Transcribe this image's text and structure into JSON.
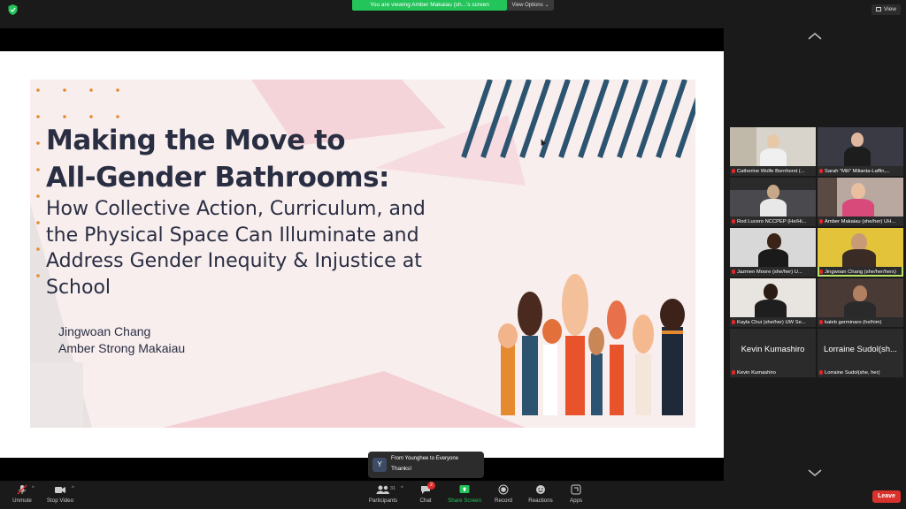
{
  "banner": {
    "viewing": "You are viewing Amber Makaiau (sh...'s screen",
    "view_options": "View Options ⌄"
  },
  "view_button": "View",
  "slide": {
    "title_line1": "Making the Move to",
    "title_line2": "All-Gender Bathrooms:",
    "subtitle_line1": "How Collective Action, Curriculum, and",
    "subtitle_line2": "the Physical Space Can Illuminate and",
    "subtitle_line3": "Address Gender Inequity & Injustice at",
    "subtitle_line4": "School",
    "author1": "Jingwoan Chang",
    "author2": "Amber Strong Makaiau",
    "colors": {
      "navy": "#2a2e42",
      "orange": "#e58a2e",
      "pink": "#f4cfd4",
      "slide_bg": "#f8eeee"
    }
  },
  "participants_panel": {
    "tiles": [
      {
        "name": "Catherine Wolfe Bornhorst (..."
      },
      {
        "name": "Sarah \"Mili\" Milianta-Laffin,..."
      },
      {
        "name": "Rod Lucero NCCPEP (He/Hi..."
      },
      {
        "name": "Amber Makaiau (she/her) UH..."
      },
      {
        "name": "Jazmen Moore (she/her) U..."
      },
      {
        "name": "Jingwoan Chang  (she/her/hers)"
      },
      {
        "name": "Kayla Chui (she/her) UW Se..."
      },
      {
        "name": "kaleb germinaro (he/him)"
      },
      {
        "name": "Kevin Kumashiro",
        "display": "Kevin Kumashiro"
      },
      {
        "name": "Lorraine Sudol(she, her)",
        "display": "Lorraine Sudol(sh..."
      }
    ]
  },
  "chat_toast": {
    "avatar": "Y",
    "from": "From Younghee to Everyone",
    "message": "Thanks!"
  },
  "toolbar": {
    "unmute": "Unmute",
    "stop_video": "Stop Video",
    "participants": "Participants",
    "participants_count": "31",
    "chat": "Chat",
    "chat_badge": "2",
    "share_screen": "Share Screen",
    "record": "Record",
    "reactions": "Reactions",
    "apps": "Apps",
    "leave": "Leave"
  }
}
